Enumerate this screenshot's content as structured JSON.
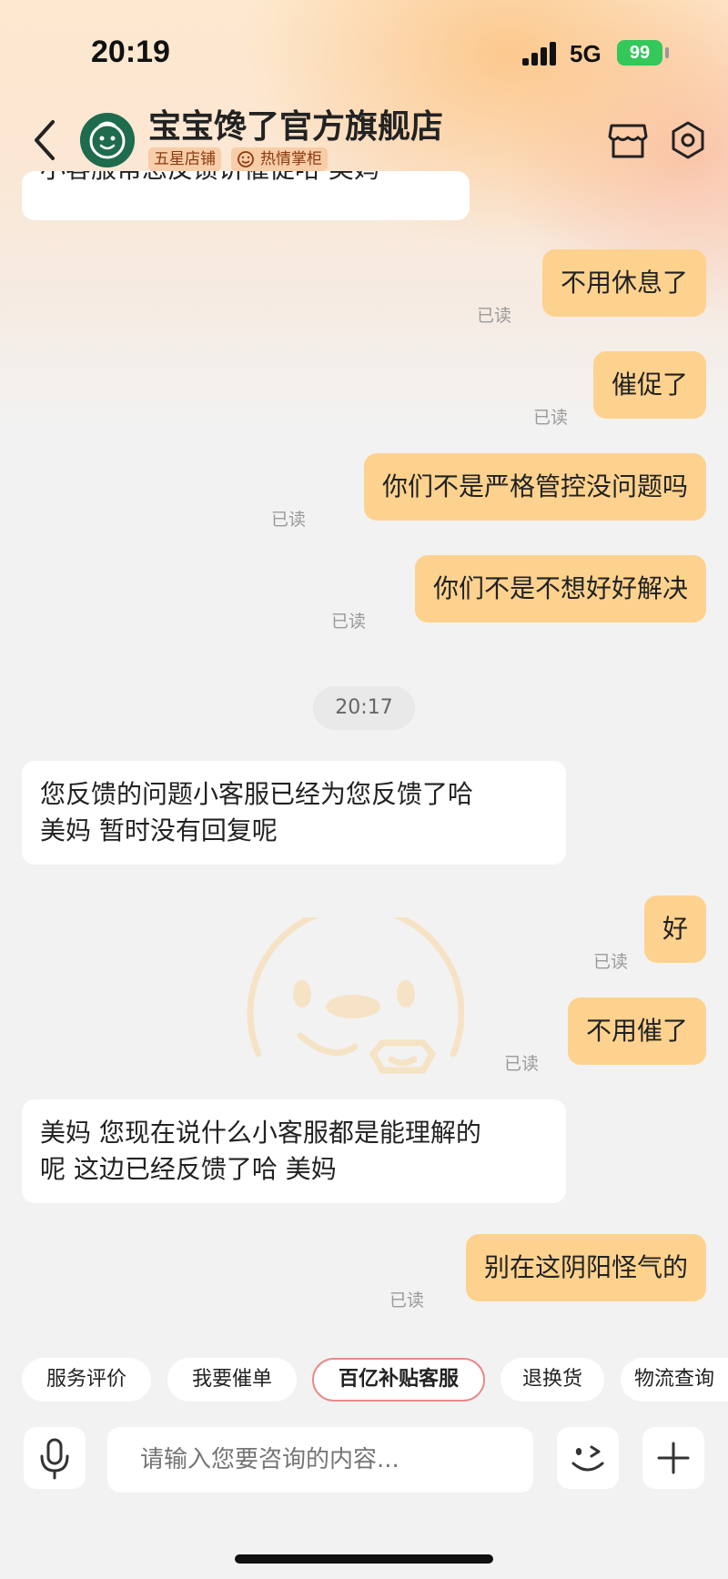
{
  "status_bar": {
    "time": "20:19",
    "network": "5G",
    "battery": "99"
  },
  "header": {
    "shop_name": "宝宝馋了官方旗舰店",
    "badges": [
      "五星店铺",
      "热情掌柜"
    ]
  },
  "messages": [
    {
      "side": "theirs",
      "text": "小客服帮您反馈讲催促哈 美妈",
      "partial": true
    },
    {
      "side": "mine",
      "text": "不用休息了",
      "status": "已读"
    },
    {
      "side": "mine",
      "text": "催促了",
      "status": "已读"
    },
    {
      "side": "mine",
      "text": "你们不是严格管控没问题吗",
      "status": "已读"
    },
    {
      "side": "mine",
      "text": "你们不是不想好好解决",
      "status": "已读"
    },
    {
      "type": "time",
      "text": "20:17"
    },
    {
      "side": "theirs",
      "lines": [
        "您反馈的问题小客服已经为您反馈了哈",
        "美妈  暂时没有回复呢"
      ]
    },
    {
      "side": "mine",
      "text": "好",
      "status": "已读"
    },
    {
      "side": "mine",
      "text": "不用催了",
      "status": "已读"
    },
    {
      "side": "theirs",
      "lines": [
        "美妈 您现在说什么小客服都是能理解的",
        "呢  这边已经反馈了哈 美妈"
      ]
    },
    {
      "side": "mine",
      "text": "别在这阴阳怪气的",
      "status": "已读"
    }
  ],
  "quick_actions": [
    "服务评价",
    "我要催单",
    "百亿补贴客服",
    "退换货",
    "物流查询"
  ],
  "input": {
    "placeholder": "请输入您要咨询的内容..."
  },
  "colors": {
    "my_bubble": "#fdd28e",
    "their_bubble": "#ffffff",
    "background": "#f2f2f2",
    "battery": "#34c759"
  }
}
